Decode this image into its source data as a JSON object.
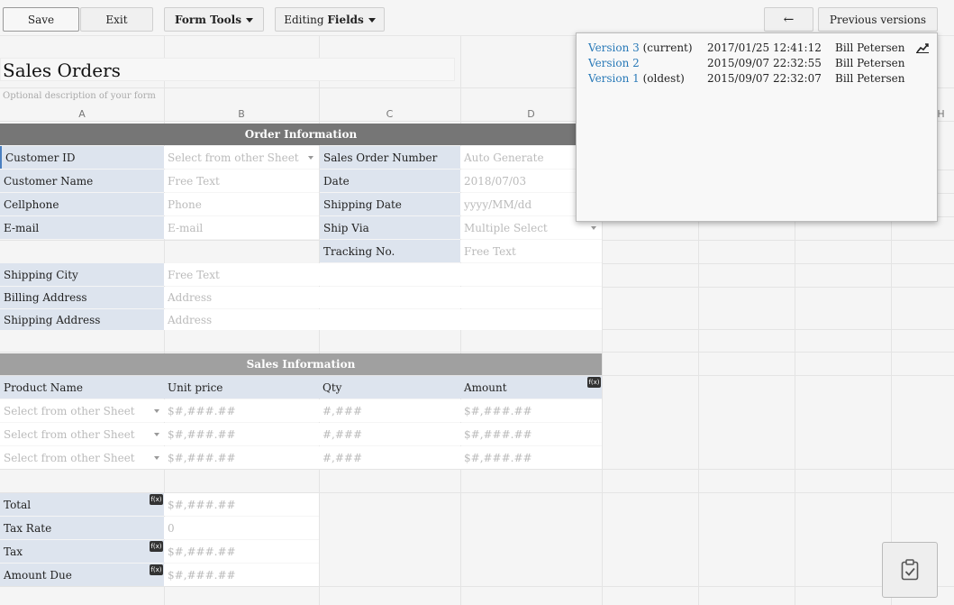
{
  "toolbar": {
    "save": "Save",
    "exit": "Exit",
    "form_tools": "Form Tools",
    "editing_prefix": "Editing ",
    "editing_bold": "Fields",
    "back_arrow": "←",
    "previous_versions": "Previous versions"
  },
  "form": {
    "title": "Sales Orders",
    "description": "Optional description of your form"
  },
  "columns": [
    "A",
    "B",
    "C",
    "D",
    "H"
  ],
  "order_section": {
    "header": "Order Information",
    "customer_id": "Customer ID",
    "customer_id_value": "Select from other Sheet",
    "sales_order_number": "Sales Order Number",
    "sales_order_number_value": "Auto Generate",
    "customer_name": "Customer Name",
    "customer_name_value": "Free Text",
    "date": "Date",
    "date_value": "2018/07/03",
    "cellphone": "Cellphone",
    "cellphone_value": "Phone",
    "shipping_date": "Shipping Date",
    "shipping_date_value": "yyyy/MM/dd",
    "email": "E-mail",
    "email_value": "E-mail",
    "ship_via": "Ship Via",
    "ship_via_value": "Multiple Select",
    "tracking_no": "Tracking No.",
    "tracking_no_value": "Free Text",
    "shipping_city": "Shipping City",
    "shipping_city_value": "Free Text",
    "billing_address": "Billing Address",
    "billing_address_value": "Address",
    "shipping_address": "Shipping Address",
    "shipping_address_value": "Address"
  },
  "sales_section": {
    "header": "Sales Information",
    "product_name": "Product Name",
    "unit_price": "Unit price",
    "qty": "Qty",
    "amount": "Amount",
    "rows": [
      {
        "product": "Select from other Sheet",
        "price": "$#,###.##",
        "qty": "#,###",
        "amount": "$#,###.##"
      },
      {
        "product": "Select from other Sheet",
        "price": "$#,###.##",
        "qty": "#,###",
        "amount": "$#,###.##"
      },
      {
        "product": "Select from other Sheet",
        "price": "$#,###.##",
        "qty": "#,###",
        "amount": "$#,###.##"
      }
    ]
  },
  "totals": {
    "total": "Total",
    "total_value": "$#,###.##",
    "tax_rate": "Tax Rate",
    "tax_rate_value": "0",
    "tax": "Tax",
    "tax_value": "$#,###.##",
    "amount_due": "Amount Due",
    "amount_due_value": "$#,###.##"
  },
  "fx_label": "f(x)",
  "versions": [
    {
      "link": "Version 3",
      "suffix": " (current)",
      "date": "2017/01/25 12:41:12",
      "user": "Bill Petersen"
    },
    {
      "link": "Version 2",
      "suffix": "",
      "date": "2015/09/07 22:32:55",
      "user": "Bill Petersen"
    },
    {
      "link": "Version 1",
      "suffix": " (oldest)",
      "date": "2015/09/07 22:32:07",
      "user": "Bill Petersen"
    }
  ],
  "icons": {
    "chart": "chart-icon",
    "clipboard": "clipboard-check-icon",
    "dropdown": "dropdown-caret-icon",
    "fx": "fx-icon"
  },
  "colors": {
    "order_header_bg": "#767676",
    "sales_header_bg": "#a0a0a0",
    "label_bg": "#dde4ee",
    "link": "#2a7ab8"
  }
}
